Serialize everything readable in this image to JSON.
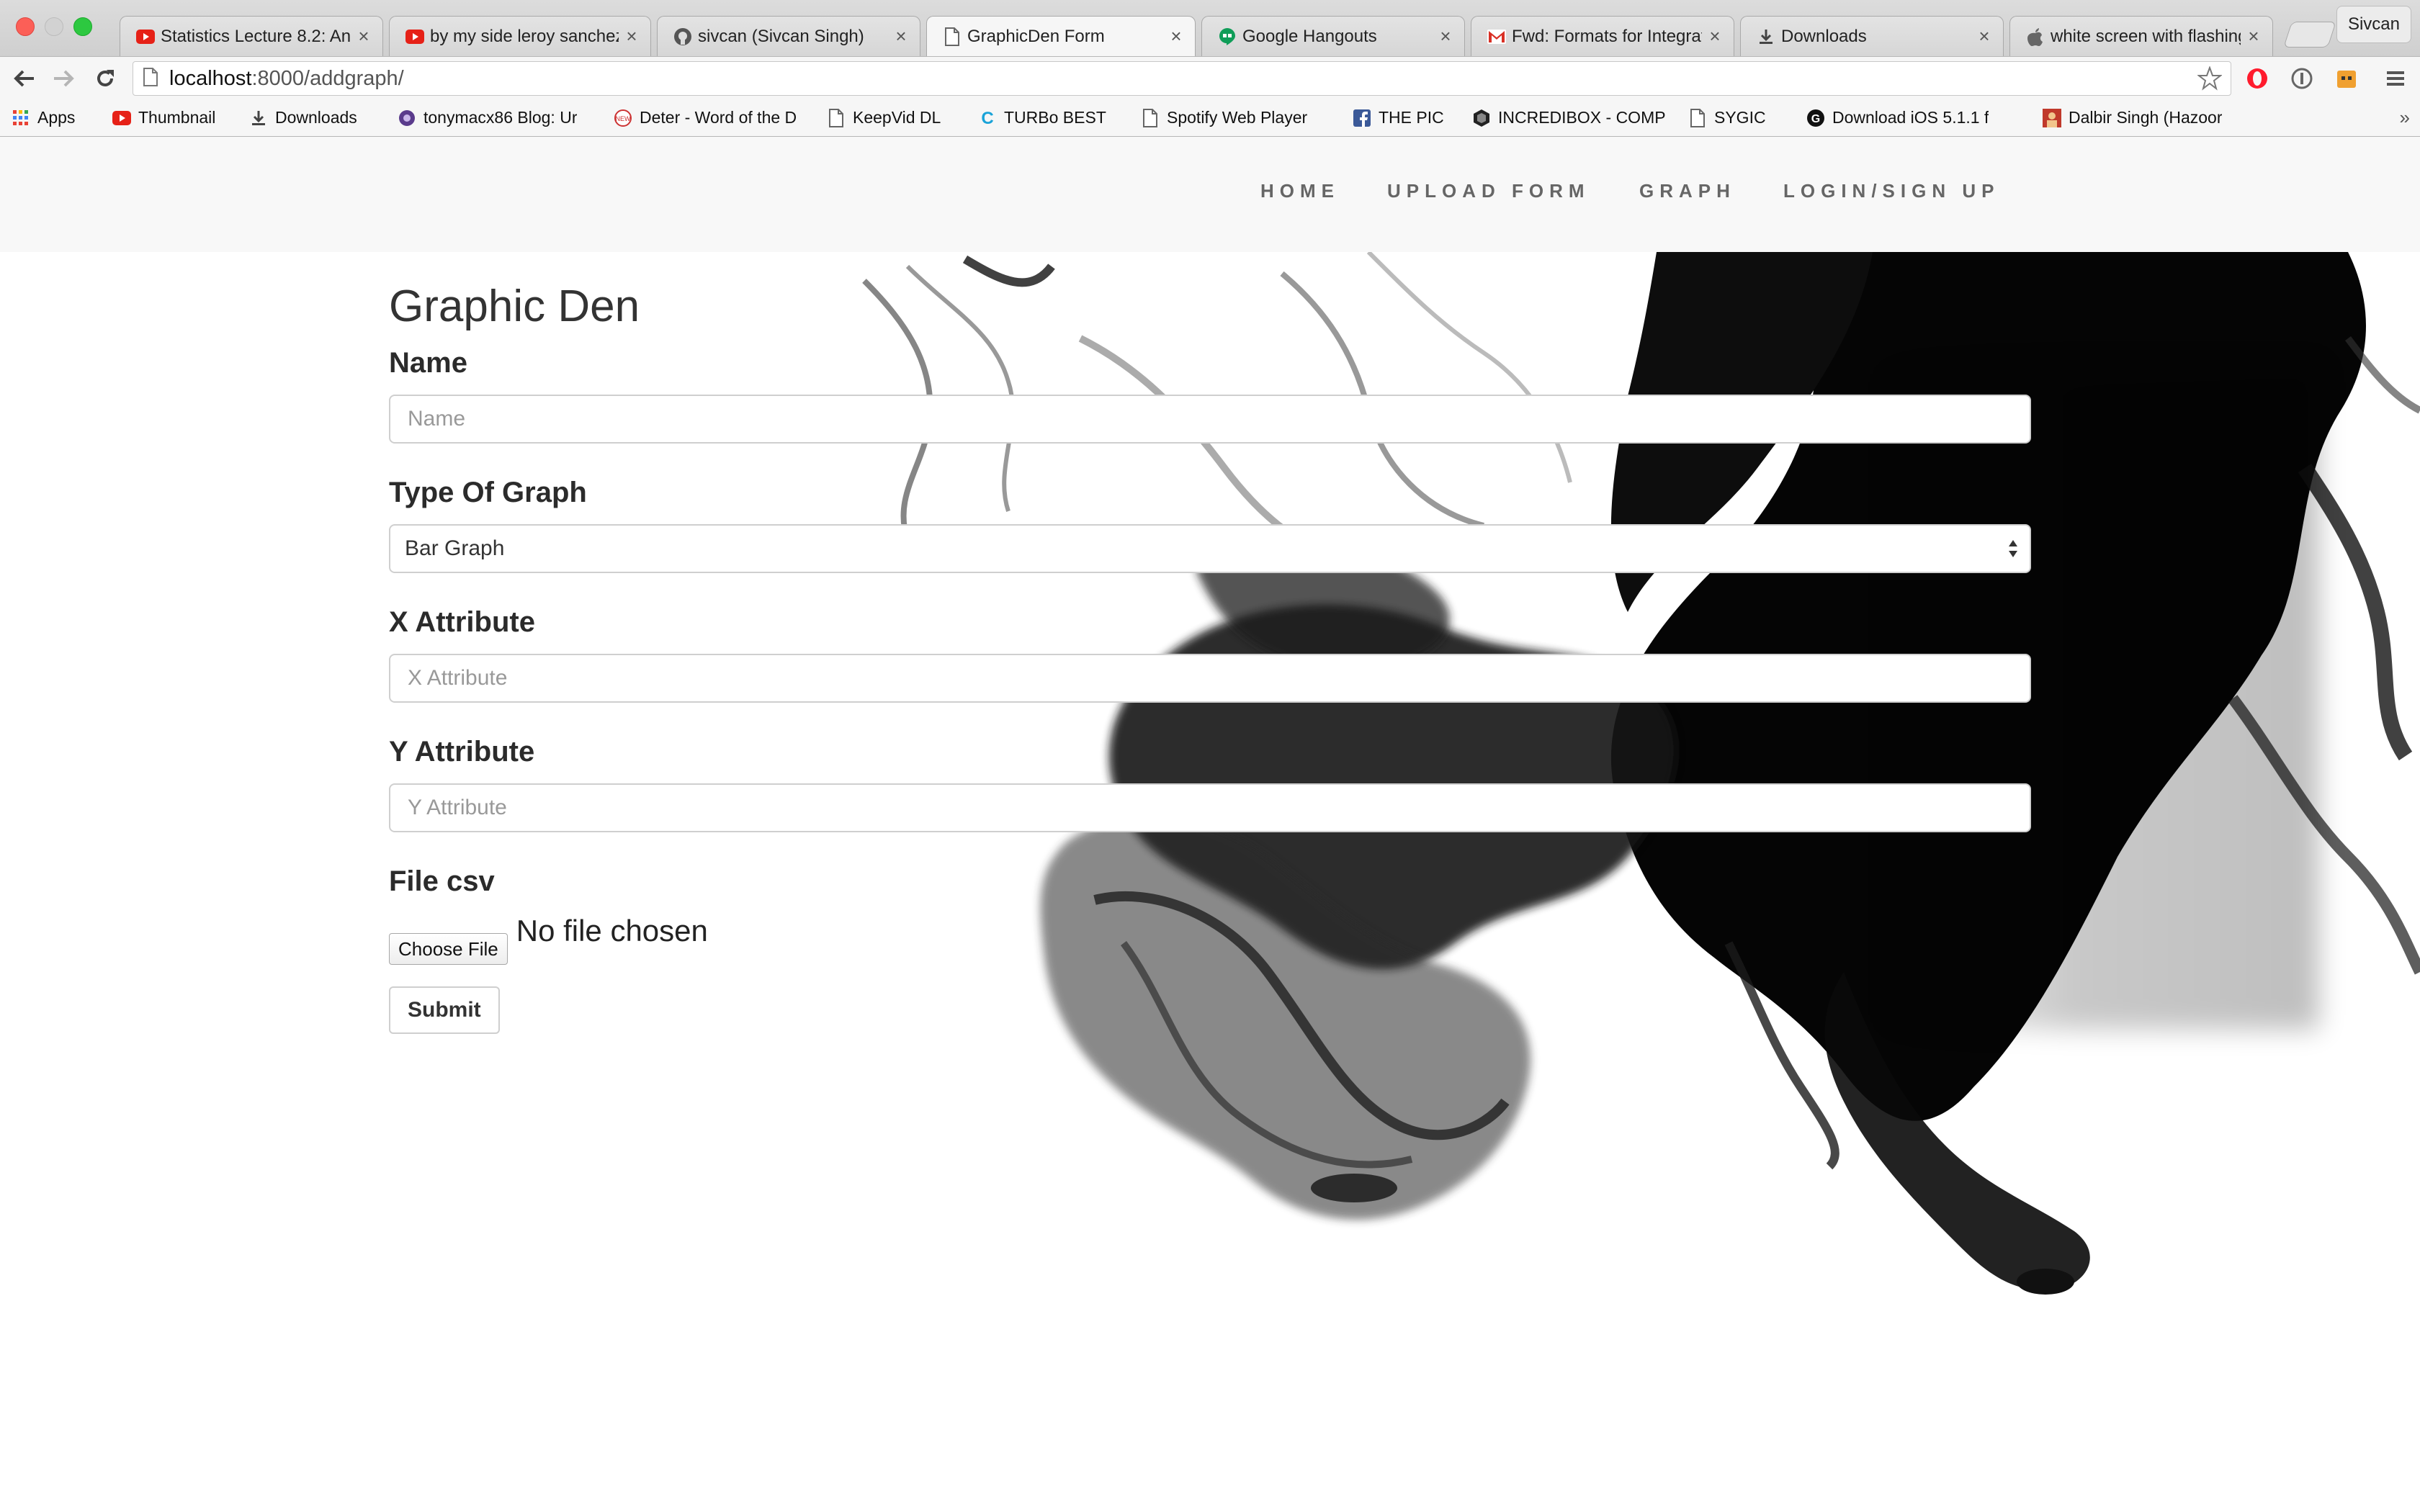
{
  "browser": {
    "tabs": [
      {
        "title": "Statistics Lecture 8.2: An",
        "favicon": "youtube-icon"
      },
      {
        "title": "by my side leroy sanchez",
        "favicon": "youtube-icon"
      },
      {
        "title": "sivcan (Sivcan Singh)",
        "favicon": "github-icon"
      },
      {
        "title": "GraphicDen Form",
        "favicon": "page-icon",
        "active": true
      },
      {
        "title": "Google Hangouts",
        "favicon": "hangouts-icon"
      },
      {
        "title": "Fwd: Formats for Integrati",
        "favicon": "gmail-icon"
      },
      {
        "title": "Downloads",
        "favicon": "download-icon"
      },
      {
        "title": "white screen with flashing",
        "favicon": "apple-icon"
      }
    ],
    "profile_name": "Sivcan",
    "url_host": "localhost",
    "url_path": ":8000/addgraph/",
    "bookmarks": [
      {
        "label": "Apps",
        "icon": "apps-grid-icon"
      },
      {
        "label": "Thumbnail",
        "icon": "youtube-icon"
      },
      {
        "label": "Downloads",
        "icon": "download-icon"
      },
      {
        "label": "tonymacx86 Blog: Ur",
        "icon": "tonymac-icon"
      },
      {
        "label": "Deter - Word of the D",
        "icon": "new-badge-icon"
      },
      {
        "label": "KeepVid DL",
        "icon": "page-icon"
      },
      {
        "label": "TURBo BEST",
        "icon": "c-logo-icon"
      },
      {
        "label": "Spotify Web Player",
        "icon": "page-icon"
      },
      {
        "label": "THE PIC",
        "icon": "facebook-icon"
      },
      {
        "label": "INCREDIBOX - COMP",
        "icon": "incredibox-icon"
      },
      {
        "label": "SYGIC",
        "icon": "page-icon"
      },
      {
        "label": "Download iOS 5.1.1 f",
        "icon": "g-logo-icon"
      },
      {
        "label": "Dalbir Singh (Hazoor",
        "icon": "portrait-icon"
      }
    ],
    "more": "»"
  },
  "site": {
    "nav": [
      "HOME",
      "UPLOAD FORM",
      "GRAPH",
      "LOGIN/SIGN UP"
    ]
  },
  "form": {
    "title": "Graphic Den",
    "name_label": "Name",
    "name_placeholder": "Name",
    "type_label": "Type Of Graph",
    "type_value": "Bar Graph",
    "x_label": "X Attribute",
    "x_placeholder": "X Attribute",
    "y_label": "Y Attribute",
    "y_placeholder": "Y Attribute",
    "file_label": "File csv",
    "choose_file": "Choose File",
    "file_status": "No file chosen",
    "submit": "Submit"
  },
  "colors": {
    "traffic_red": "#fc5f57",
    "traffic_green": "#2dc840",
    "ink": "#0a0a0a"
  }
}
